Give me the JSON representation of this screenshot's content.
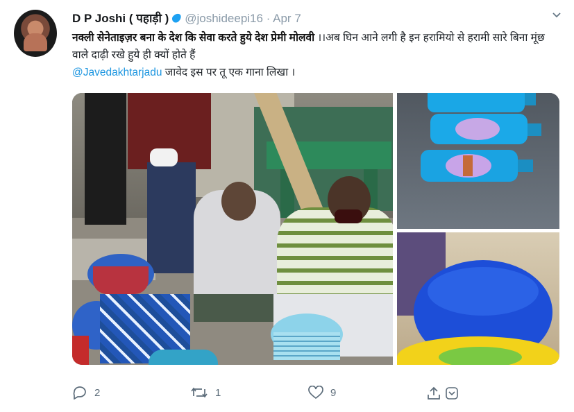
{
  "tweet": {
    "author_name": "D P Joshi ( पहाड़ी )",
    "handle": "@joshideepi16",
    "date_sep": " · ",
    "date": "Apr 7",
    "text_highlight": "नक्ली सेनेताइज़र बना के देश कि  सेवा करते हुये देश प्रेमी मोलवी",
    "text_rest": " ।।अब घिन आने लगी है इन हरामियो से हरामी सारे बिना मूंछ वाले दाढ़ी रखे हुये ही क्यों होते हैं ",
    "mention": "@Javedakhtarjadu",
    "text_end": " जावेद इस पर तू एक गाना लिखा ।"
  },
  "actions": {
    "reply_count": "2",
    "retweet_count": "1",
    "like_count": "9"
  },
  "icons": [
    "verified-drop-icon",
    "chevron-down-icon",
    "reply-icon",
    "retweet-icon",
    "like-icon",
    "share-icon",
    "bookmark-icon"
  ],
  "colors": {
    "link": "#1b95e0",
    "muted": "#5b6b79",
    "verified": "#1da1f2"
  }
}
